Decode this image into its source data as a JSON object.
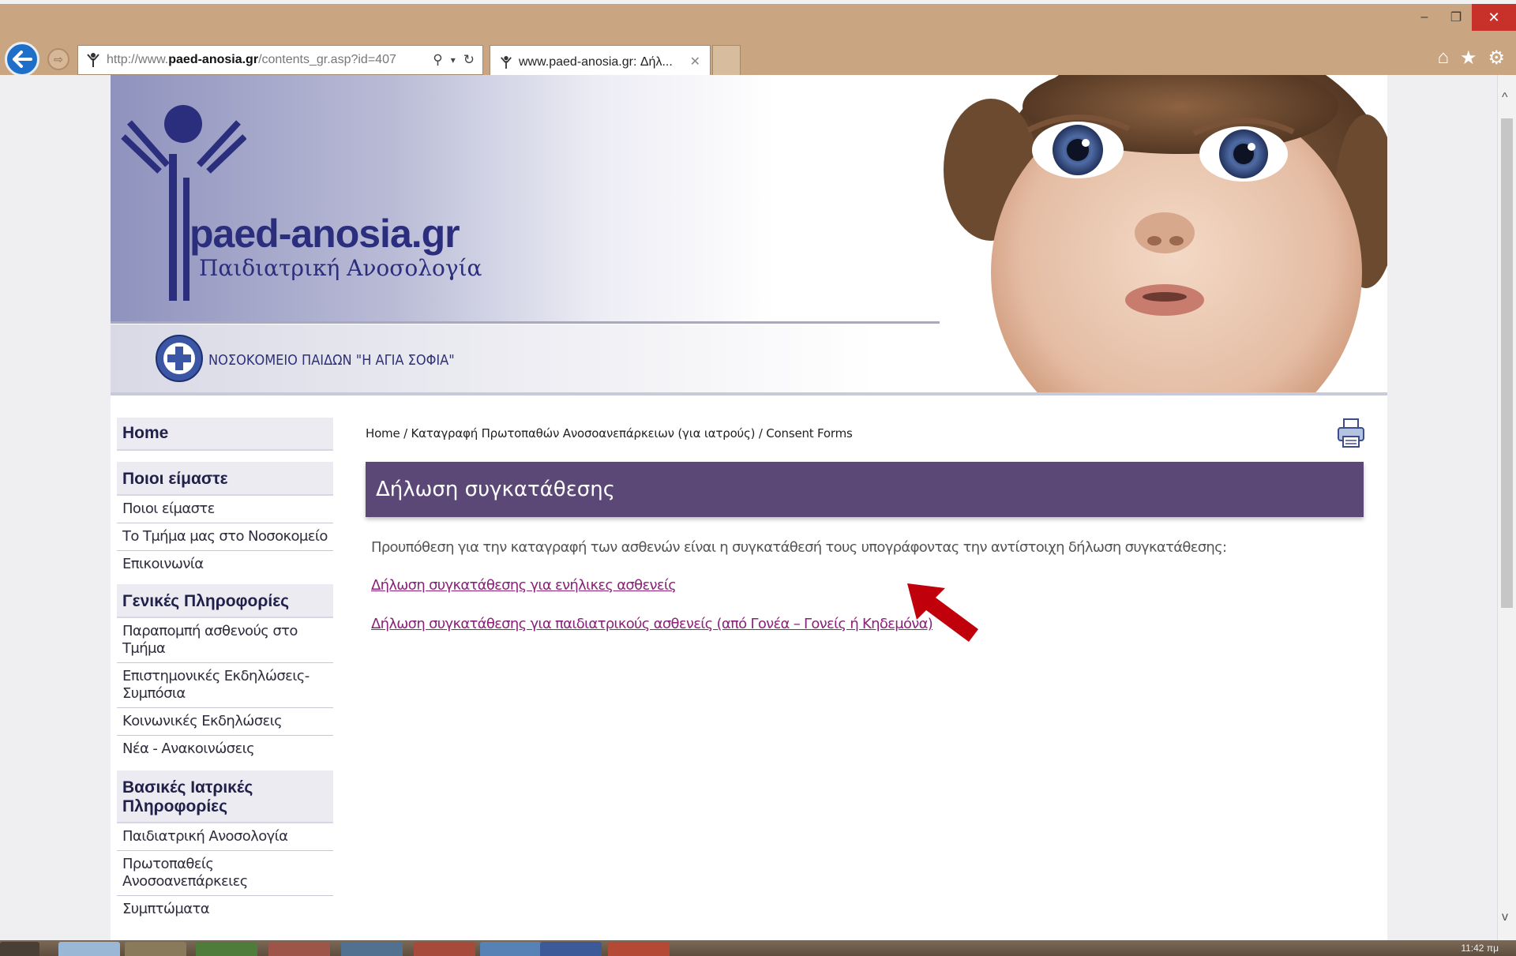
{
  "browser": {
    "url_prefix": "http://www.",
    "url_host": "paed-anosia.gr",
    "url_path": "/contents_gr.asp?id=407",
    "tab_title": "www.paed-anosia.gr: Δήλ...",
    "window_buttons": {
      "minimize": "–",
      "restore": "❐",
      "close": "✕"
    },
    "icons": [
      "back-icon",
      "forward-icon",
      "site-favicon",
      "search-icon",
      "refresh-icon",
      "home-icon",
      "favorites-star-icon",
      "settings-gear-icon"
    ]
  },
  "banner": {
    "site_title": "paed-anosia.gr",
    "site_subtitle": "Παιδιατρική Ανοσολογία",
    "hospital": "ΝΟΣΟΚΟΜΕΙΟ ΠΑΙΔΩΝ \"Η ΑΓΙΑ ΣΟΦΙΑ\""
  },
  "sidebar": {
    "home": "Home",
    "sections": [
      {
        "title": "Ποιοι είμαστε",
        "items": [
          "Ποιοι είμαστε",
          "Το Τμήμα μας στο Νοσοκομείο",
          "Επικοινωνία"
        ]
      },
      {
        "title": "Γενικές Πληροφορίες",
        "items": [
          "Παραπομπή ασθενούς στο Τμήμα",
          "Επιστημονικές Εκδηλώσεις-Συμπόσια",
          "Κοινωνικές Εκδηλώσεις",
          "Νέα - Ανακοινώσεις"
        ]
      },
      {
        "title": "Βασικές Ιατρικές Πληροφορίες",
        "items": [
          "Παιδιατρική Ανοσολογία",
          "Πρωτοπαθείς Ανοσοανεπάρκειες",
          "Συμπτώματα"
        ]
      }
    ]
  },
  "main": {
    "breadcrumb": "Home / Καταγραφή Πρωτοπαθών Ανοσοανεπάρκειων (για ιατρούς) / Consent Forms",
    "page_title": "Δήλωση συγκατάθεσης",
    "intro": "Προυπόθεση για την καταγραφή των ασθενών είναι η συγκατάθεσή τους υπογράφοντας την αντίστοιχη δήλωση συγκατάθεσης:",
    "links": [
      "Δήλωση συγκατάθεσης για ενήλικες ασθενείς",
      "Δήλωση συγκατάθεσης για παιδιατρικούς ασθενείς (από Γονέα – Γονείς ή Κηδεμόνα)"
    ]
  },
  "taskbar": {
    "clock": "11:42 πμ"
  },
  "colors": {
    "chrome": "#c9a581",
    "title_bar": "#5c4877",
    "link": "#8a227a",
    "brand": "#2b2e7c",
    "annotation_arrow": "#c0000b"
  }
}
